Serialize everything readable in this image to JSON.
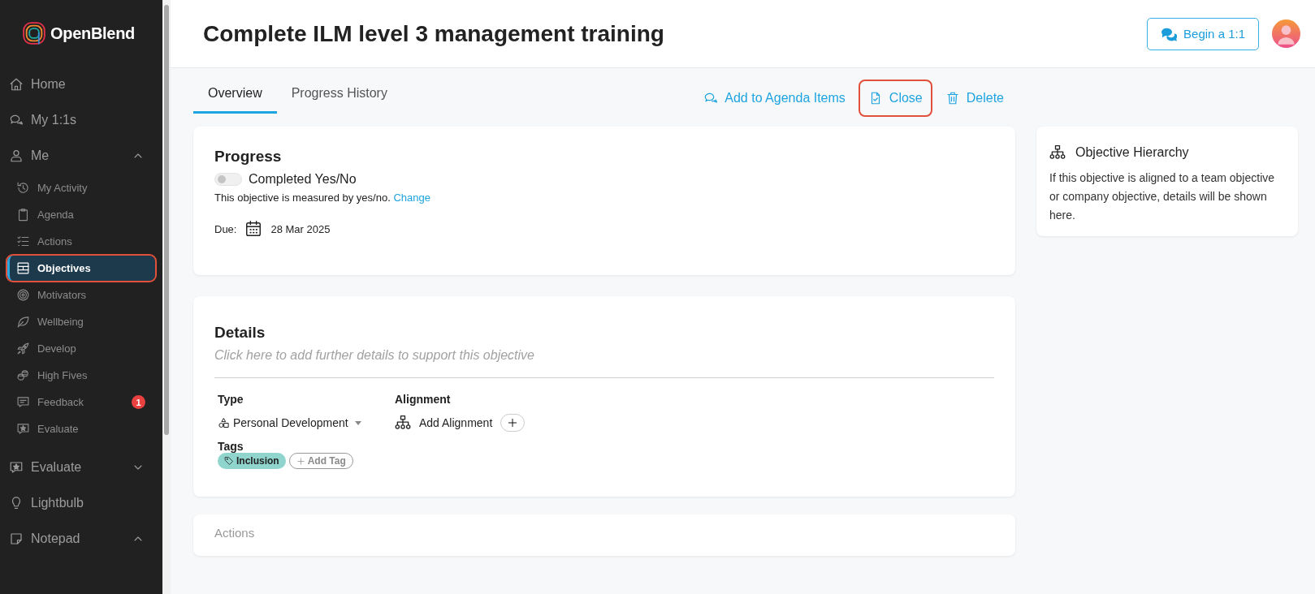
{
  "sidebar": {
    "logo": "OpenBlend",
    "items": [
      {
        "label": "Home",
        "selected": false
      },
      {
        "label": "My 1:1s",
        "selected": false
      },
      {
        "label": "Me",
        "selected": false,
        "expanded": true,
        "children": [
          {
            "label": "My Activity",
            "selected": false,
            "highlighted": false
          },
          {
            "label": "Agenda",
            "selected": false,
            "highlighted": false
          },
          {
            "label": "Actions",
            "selected": false,
            "highlighted": false
          },
          {
            "label": "Objectives",
            "selected": true,
            "highlighted": true
          },
          {
            "label": "Motivators",
            "selected": false,
            "highlighted": false
          },
          {
            "label": "Wellbeing",
            "selected": false,
            "highlighted": false
          },
          {
            "label": "Develop",
            "selected": false,
            "highlighted": false
          },
          {
            "label": "High Fives",
            "selected": false,
            "highlighted": false
          },
          {
            "label": "Feedback",
            "selected": false,
            "highlighted": false,
            "badge": "1"
          },
          {
            "label": "Evaluate",
            "selected": false,
            "highlighted": false
          }
        ]
      },
      {
        "label": "Evaluate",
        "selected": false,
        "expanded": false
      },
      {
        "label": "Lightbulb",
        "selected": false
      },
      {
        "label": "Notepad",
        "selected": false,
        "expanded": true
      }
    ]
  },
  "header": {
    "title": "Complete ILM level 3 management training",
    "begin_button": "Begin a 1:1"
  },
  "tabs": [
    {
      "label": "Overview",
      "selected": true
    },
    {
      "label": "Progress History",
      "selected": false
    }
  ],
  "actions": [
    {
      "label": "Add to Agenda Items",
      "highlighted": false
    },
    {
      "label": "Close",
      "highlighted": true
    },
    {
      "label": "Delete",
      "highlighted": false
    }
  ],
  "progress": {
    "heading": "Progress",
    "toggle": {
      "label": "Completed Yes/No",
      "on": false
    },
    "measure_text": "This objective is measured by yes/no.",
    "change_link": "Change",
    "due_label": "Due:",
    "due_date": "28 Mar 2025"
  },
  "details": {
    "heading": "Details",
    "placeholder": "Click here to add further details to support this objective",
    "type_label": "Type",
    "type_value": "Personal Development",
    "alignment_label": "Alignment",
    "alignment_value": "Add Alignment",
    "tags_label": "Tags",
    "tags": [
      {
        "label": "Inclusion"
      }
    ],
    "add_tag": "Add Tag"
  },
  "actions_card": {
    "heading": "Actions"
  },
  "hierarchy": {
    "heading": "Objective Hierarchy",
    "text": "If this objective is aligned to a team objective or company objective, details will be shown here."
  }
}
